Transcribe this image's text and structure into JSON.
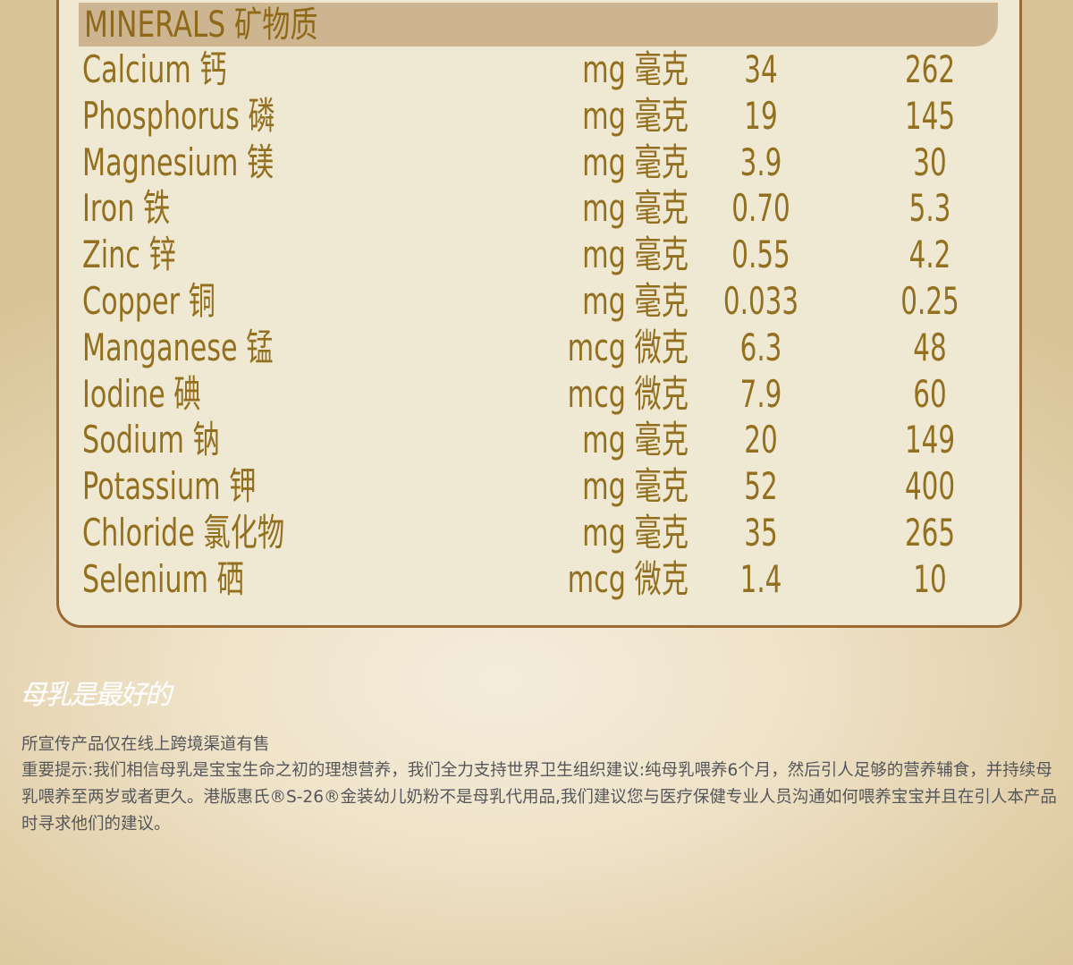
{
  "section_title": "MINERALS 矿物质",
  "minerals": [
    {
      "name": "Calcium 钙",
      "unit": "mg 毫克",
      "per_100kj": "34",
      "per_100g": "262"
    },
    {
      "name": "Phosphorus 磷",
      "unit": "mg 毫克",
      "per_100kj": "19",
      "per_100g": "145"
    },
    {
      "name": "Magnesium 镁",
      "unit": "mg 毫克",
      "per_100kj": "3.9",
      "per_100g": "30"
    },
    {
      "name": "Iron 铁",
      "unit": "mg 毫克",
      "per_100kj": "0.70",
      "per_100g": "5.3"
    },
    {
      "name": "Zinc 锌",
      "unit": "mg 毫克",
      "per_100kj": "0.55",
      "per_100g": "4.2"
    },
    {
      "name": "Copper 铜",
      "unit": "mg 毫克",
      "per_100kj": "0.033",
      "per_100g": "0.25"
    },
    {
      "name": "Manganese 锰",
      "unit": "mcg 微克",
      "per_100kj": "6.3",
      "per_100g": "48"
    },
    {
      "name": "Iodine 碘",
      "unit": "mcg 微克",
      "per_100kj": "7.9",
      "per_100g": "60"
    },
    {
      "name": "Sodium 钠",
      "unit": "mg 毫克",
      "per_100kj": "20",
      "per_100g": "149"
    },
    {
      "name": "Potassium 钾",
      "unit": "mg 毫克",
      "per_100kj": "52",
      "per_100g": "400"
    },
    {
      "name": "Chloride 氯化物",
      "unit": "mg 毫克",
      "per_100kj": "35",
      "per_100g": "265"
    },
    {
      "name": "Selenium 硒",
      "unit": "mcg 微克",
      "per_100kj": "1.4",
      "per_100g": "10"
    }
  ],
  "signature_text": "母乳是最好的",
  "notice": "所宣传产品仅在线上跨境渠道有售",
  "important_notice": "重要提示:我们相信母乳是宝宝生命之初的理想营养，我们全力支持世界卫生组织建议:纯母乳喂养6个月，然后引人足够的营养辅食，并持续母乳喂养至两岁或者更久。港版惠氏®S-26®金装幼儿奶粉不是母乳代用品,我们建议您与医疗保健专业人员沟通如何喂养宝宝并且在引人本产品时寻求他们的建议。",
  "colors": {
    "text_gold": "#93701f",
    "panel_bg": "#efe8d2",
    "panel_border": "#9a6a32",
    "header_band": "#cdb592",
    "notice_text": "#55575a"
  }
}
